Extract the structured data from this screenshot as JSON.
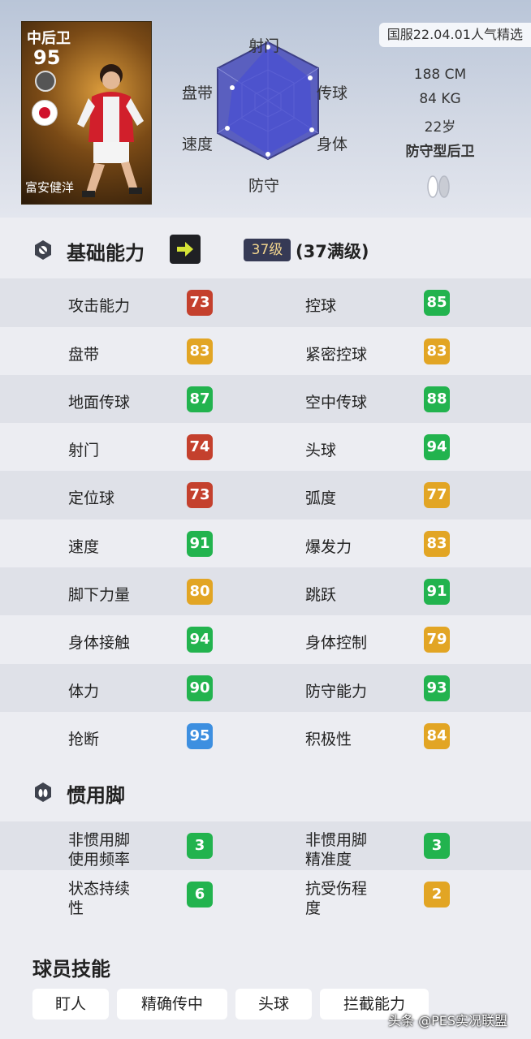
{
  "header": {
    "tag": "国服22.04.01人气精选",
    "card": {
      "position": "中后卫",
      "rating": "95",
      "name": "富安健洋"
    },
    "radar_labels": {
      "top": "射门",
      "upper_left": "盘带",
      "upper_right": "传球",
      "lower_left": "速度",
      "lower_right": "身体",
      "bottom": "防守"
    },
    "bio": {
      "height": "188 CM",
      "weight": "84 KG",
      "age": "22岁",
      "style": "防守型后卫"
    }
  },
  "basic": {
    "title": "基础能力",
    "level_badge": "37级",
    "level_text": "(37满级)",
    "rows": [
      {
        "left": {
          "label": "攻击能力",
          "value": "73",
          "color": "#c4402d"
        },
        "right": {
          "label": "控球",
          "value": "85",
          "color": "#22b34e"
        }
      },
      {
        "left": {
          "label": "盘带",
          "value": "83",
          "color": "#e2a524"
        },
        "right": {
          "label": "紧密控球",
          "value": "83",
          "color": "#e2a524"
        }
      },
      {
        "left": {
          "label": "地面传球",
          "value": "87",
          "color": "#22b34e"
        },
        "right": {
          "label": "空中传球",
          "value": "88",
          "color": "#22b34e"
        }
      },
      {
        "left": {
          "label": "射门",
          "value": "74",
          "color": "#c4402d"
        },
        "right": {
          "label": "头球",
          "value": "94",
          "color": "#22b34e"
        }
      },
      {
        "left": {
          "label": "定位球",
          "value": "73",
          "color": "#c4402d"
        },
        "right": {
          "label": "弧度",
          "value": "77",
          "color": "#e2a524"
        }
      },
      {
        "left": {
          "label": "速度",
          "value": "91",
          "color": "#22b34e"
        },
        "right": {
          "label": "爆发力",
          "value": "83",
          "color": "#e2a524"
        }
      },
      {
        "left": {
          "label": "脚下力量",
          "value": "80",
          "color": "#e2a524"
        },
        "right": {
          "label": "跳跃",
          "value": "91",
          "color": "#22b34e"
        }
      },
      {
        "left": {
          "label": "身体接触",
          "value": "94",
          "color": "#22b34e"
        },
        "right": {
          "label": "身体控制",
          "value": "79",
          "color": "#e2a524"
        }
      },
      {
        "left": {
          "label": "体力",
          "value": "90",
          "color": "#22b34e"
        },
        "right": {
          "label": "防守能力",
          "value": "93",
          "color": "#22b34e"
        }
      },
      {
        "left": {
          "label": "抢断",
          "value": "95",
          "color": "#3d8fe0"
        },
        "right": {
          "label": "积极性",
          "value": "84",
          "color": "#e2a524"
        }
      }
    ]
  },
  "foot": {
    "title": "惯用脚",
    "rows": [
      {
        "left": {
          "label1": "非惯用脚",
          "label2": "使用频率",
          "value": "3",
          "color": "#22b34e"
        },
        "right": {
          "label1": "非惯用脚",
          "label2": "精准度",
          "value": "3",
          "color": "#22b34e"
        }
      },
      {
        "left": {
          "label1": "状态持续",
          "label2": "性",
          "value": "6",
          "color": "#22b34e"
        },
        "right": {
          "label1": "抗受伤程",
          "label2": "度",
          "value": "2",
          "color": "#e2a524"
        }
      }
    ]
  },
  "skills": {
    "title": "球员技能",
    "items": [
      "盯人",
      "精确传中",
      "头球",
      "拦截能力"
    ]
  },
  "watermark": "头条 @PES实况联盟"
}
